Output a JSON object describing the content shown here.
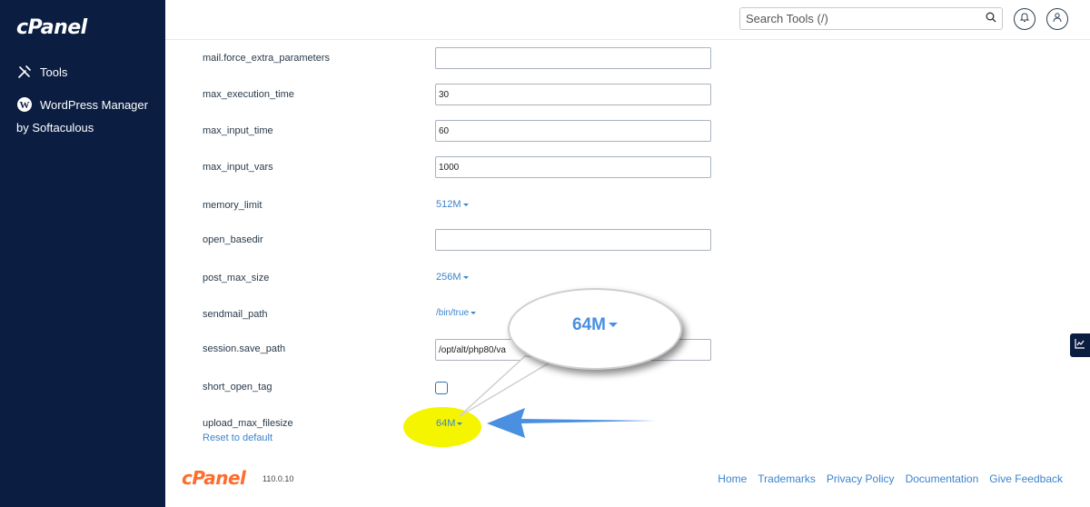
{
  "sidebar": {
    "logo": "cPanel",
    "items": [
      {
        "label": "Tools",
        "icon": "tools-icon"
      },
      {
        "label": "WordPress Manager",
        "sub": "by Softaculous",
        "icon": "wordpress-icon"
      }
    ]
  },
  "header": {
    "search_placeholder": "Search Tools (/)"
  },
  "form": {
    "rows": [
      {
        "name": "mail.force_extra_parameters",
        "value": ""
      },
      {
        "name": "max_execution_time",
        "value": "30"
      },
      {
        "name": "max_input_time",
        "value": "60"
      },
      {
        "name": "max_input_vars",
        "value": "1000"
      },
      {
        "name": "memory_limit",
        "value": "512M"
      },
      {
        "name": "open_basedir",
        "value": ""
      },
      {
        "name": "post_max_size",
        "value": "256M"
      },
      {
        "name": "sendmail_path",
        "value": "/bin/true"
      },
      {
        "name": "session.save_path",
        "value": "/opt/alt/php80/va"
      },
      {
        "name": "short_open_tag",
        "value": ""
      },
      {
        "name": "upload_max_filesize",
        "value": "64M"
      }
    ],
    "reset_label": "Reset to default"
  },
  "callout": {
    "text": "64M"
  },
  "footer": {
    "logo": "cPanel",
    "version": "110.0.10",
    "links": [
      "Home",
      "Trademarks",
      "Privacy Policy",
      "Documentation",
      "Give Feedback"
    ]
  },
  "colors": {
    "sidebar_bg": "#0b1e42",
    "link": "#3c84cc",
    "highlight": "#f5f500",
    "arrow": "#4a8fe0",
    "brand_orange": "#ff6c2c"
  }
}
